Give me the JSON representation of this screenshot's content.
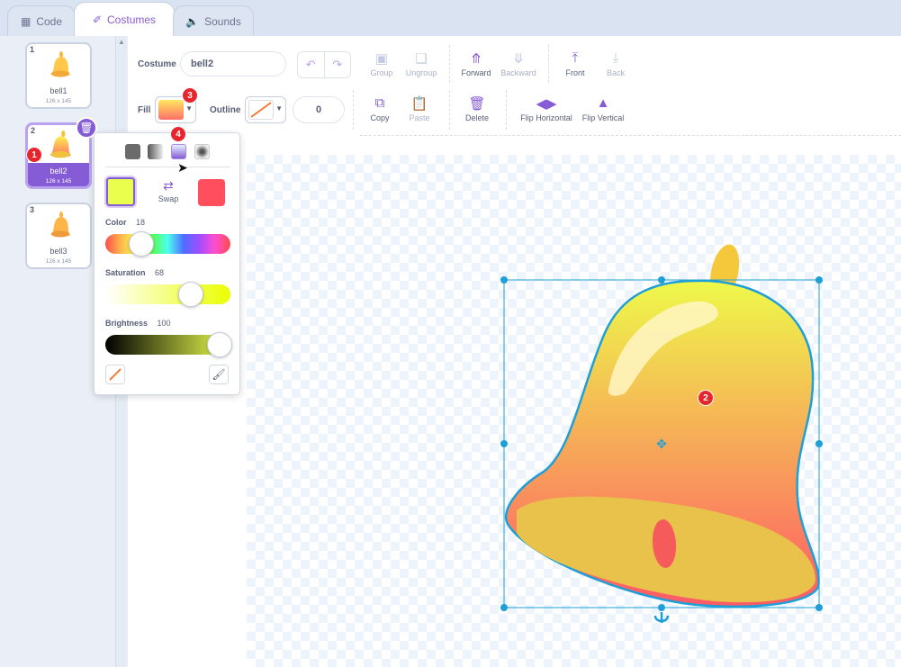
{
  "tabs": [
    {
      "label": "Code",
      "icon": "code-icon"
    },
    {
      "label": "Costumes",
      "icon": "brush-icon"
    },
    {
      "label": "Sounds",
      "icon": "speaker-icon"
    }
  ],
  "costumes": [
    {
      "num": "1",
      "name": "bell1",
      "size": "126 x 145"
    },
    {
      "num": "2",
      "name": "bell2",
      "size": "126 x 145"
    },
    {
      "num": "3",
      "name": "bell3",
      "size": "126 x 145"
    }
  ],
  "toolbar": {
    "costume_label": "Costume",
    "costume_name": "bell2",
    "group": "Group",
    "ungroup": "Ungroup",
    "forward": "Forward",
    "backward": "Backward",
    "front": "Front",
    "back": "Back",
    "fill_label": "Fill",
    "outline_label": "Outline",
    "outline_width": "0",
    "copy": "Copy",
    "paste": "Paste",
    "delete": "Delete",
    "flip_h": "Flip Horizontal",
    "flip_v": "Flip Vertical"
  },
  "color_picker": {
    "swap_label": "Swap",
    "color_label": "Color",
    "color_value": "18",
    "saturation_label": "Saturation",
    "saturation_value": "68",
    "brightness_label": "Brightness",
    "brightness_value": "100",
    "color_level": 0.18,
    "saturation_level": 0.68,
    "brightness_level": 1.0,
    "first_color": "#eaff4d",
    "second_color": "#ff4f5e"
  },
  "annotations": [
    "1",
    "2",
    "3",
    "4"
  ],
  "colors": {
    "accent": "#855cd6",
    "selection": "#1a9ed8"
  }
}
